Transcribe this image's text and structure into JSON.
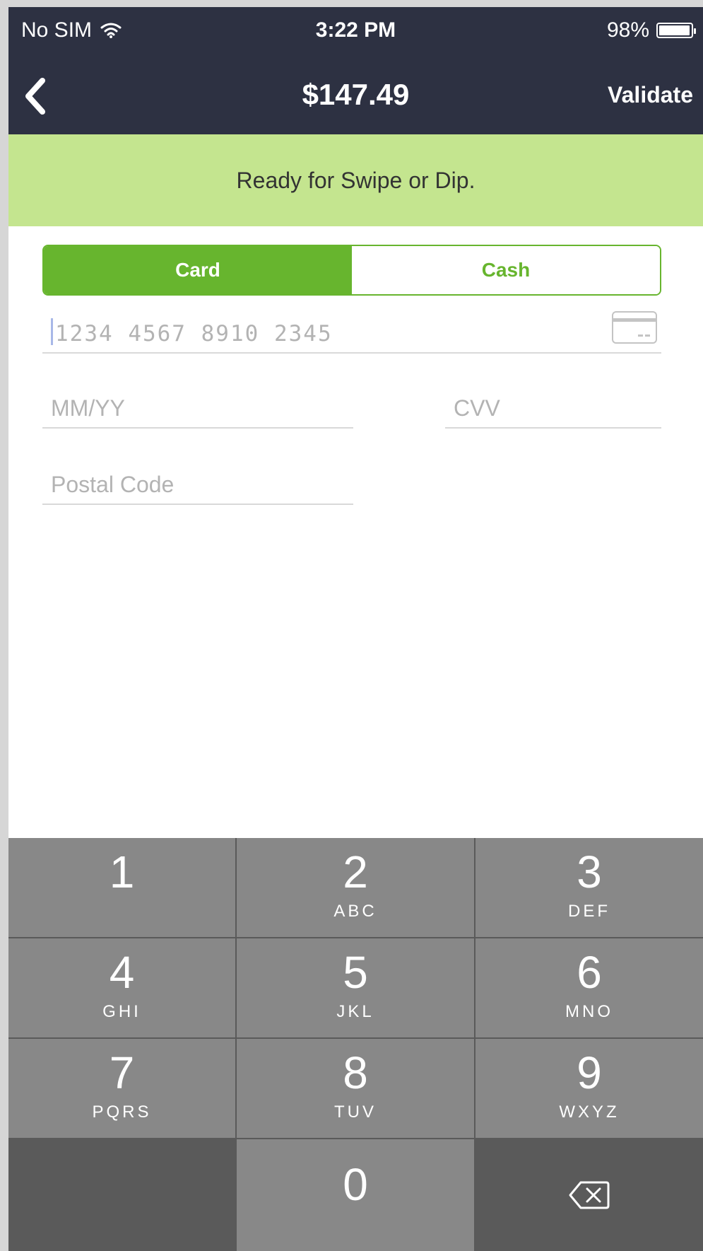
{
  "status_bar": {
    "carrier": "No SIM",
    "time": "3:22 PM",
    "battery_percent": "98%",
    "battery_level": 0.98
  },
  "nav": {
    "title": "$147.49",
    "validate_label": "Validate",
    "back_icon": "chevron-left-icon"
  },
  "banner": {
    "message": "Ready for Swipe or Dip."
  },
  "payment_tabs": [
    {
      "label": "Card",
      "selected": true
    },
    {
      "label": "Cash",
      "selected": false
    }
  ],
  "form": {
    "card_number_placeholder": "1234 4567 8910 2345",
    "expiry_placeholder": "MM/YY",
    "cvv_placeholder": "CVV",
    "postal_placeholder": "Postal Code"
  },
  "keypad": {
    "keys": [
      {
        "digit": "1",
        "letters": ""
      },
      {
        "digit": "2",
        "letters": "ABC"
      },
      {
        "digit": "3",
        "letters": "DEF"
      },
      {
        "digit": "4",
        "letters": "GHI"
      },
      {
        "digit": "5",
        "letters": "JKL"
      },
      {
        "digit": "6",
        "letters": "MNO"
      },
      {
        "digit": "7",
        "letters": "PQRS"
      },
      {
        "digit": "8",
        "letters": "TUV"
      },
      {
        "digit": "9",
        "letters": "WXYZ"
      },
      {
        "digit": "0",
        "letters": ""
      }
    ],
    "delete_icon": "backspace-icon"
  },
  "colors": {
    "header_bg": "#2d3142",
    "banner_bg": "#c4e58f",
    "accent_green": "#67b52e",
    "key_light": "#888888",
    "key_dark": "#5a5a5a"
  }
}
